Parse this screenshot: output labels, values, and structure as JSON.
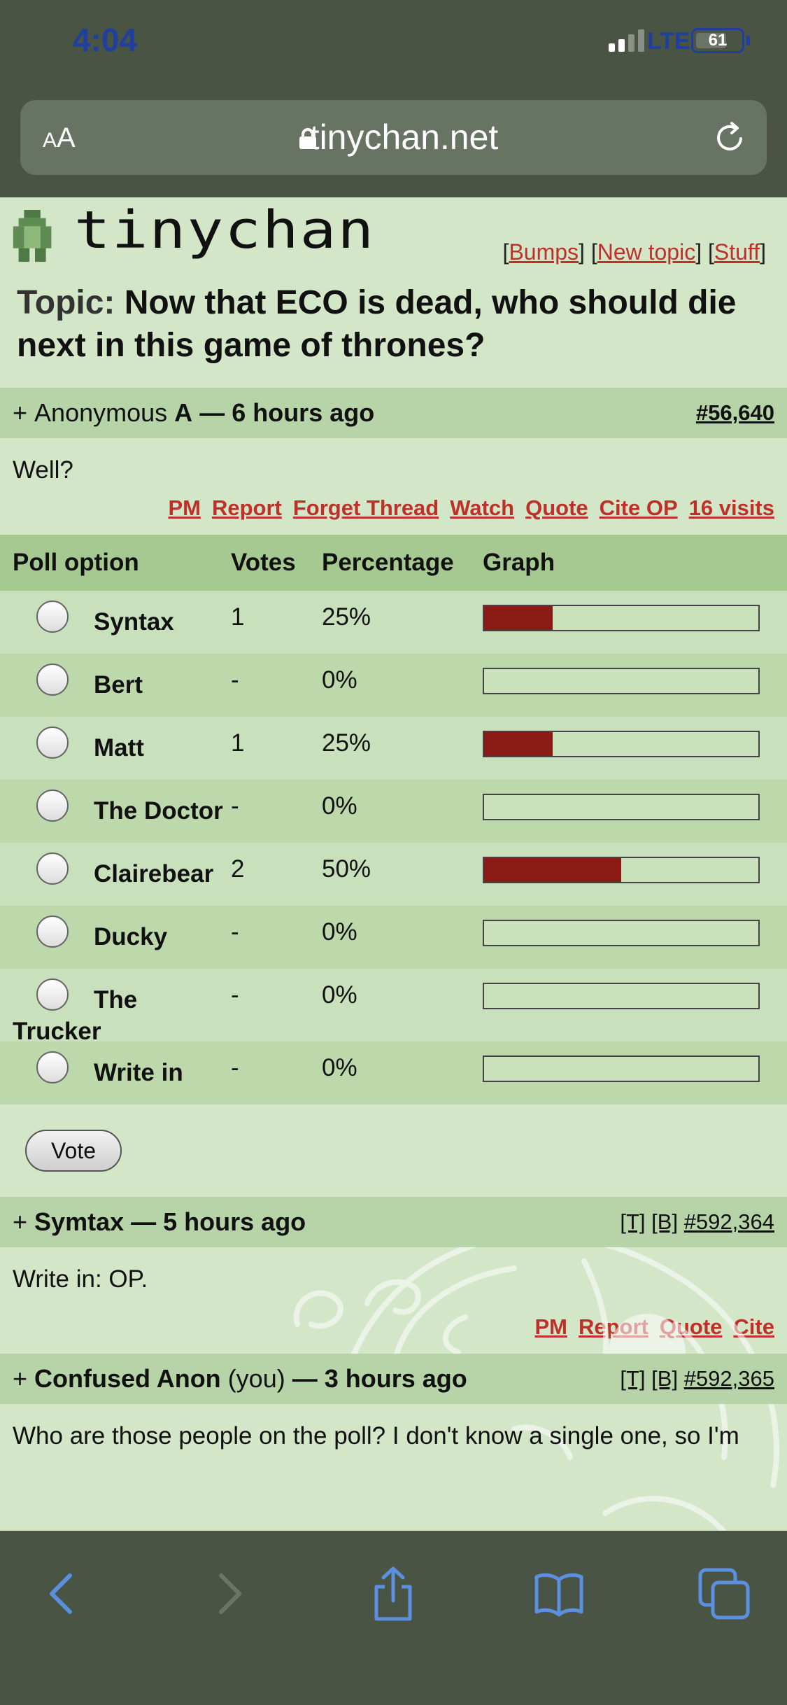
{
  "status": {
    "time": "4:04",
    "network": "LTE",
    "battery": "61"
  },
  "browser": {
    "text_size_label": "AA",
    "url": "tinychan.net"
  },
  "site": {
    "logo": "tinychan",
    "links": [
      "Bumps",
      "New topic",
      "Stuff"
    ]
  },
  "topic": {
    "label": "Topic:",
    "title": "Now that ECO is dead, who should die next in this game of thrones?"
  },
  "op": {
    "expand": "+",
    "author": "Anonymous",
    "author_tag": "A",
    "time": "— 6 hours ago",
    "id": "#56,640",
    "body": "Well?",
    "actions": [
      "PM",
      "Report",
      "Forget Thread",
      "Watch",
      "Quote",
      "Cite OP",
      "16 visits"
    ]
  },
  "poll": {
    "headers": {
      "option": "Poll option",
      "votes": "Votes",
      "percentage": "Percentage",
      "graph": "Graph"
    },
    "options": [
      {
        "name": "Syntax",
        "votes": "1",
        "percentage": "25%",
        "fraction": 0.25
      },
      {
        "name": "Bert",
        "votes": "-",
        "percentage": "0%",
        "fraction": 0
      },
      {
        "name": "Matt",
        "votes": "1",
        "percentage": "25%",
        "fraction": 0.25
      },
      {
        "name": "The Doctor",
        "votes": "-",
        "percentage": "0%",
        "fraction": 0
      },
      {
        "name": "Clairebear",
        "votes": "2",
        "percentage": "50%",
        "fraction": 0.5
      },
      {
        "name": "Ducky",
        "votes": "-",
        "percentage": "0%",
        "fraction": 0
      },
      {
        "name": "The Trucker",
        "votes": "-",
        "percentage": "0%",
        "fraction": 0
      },
      {
        "name": "Write in",
        "votes": "-",
        "percentage": "0%",
        "fraction": 0
      }
    ],
    "vote_button": "Vote",
    "bar_color": "#8a1a14"
  },
  "replies": [
    {
      "expand": "+",
      "author": "Symtax",
      "time": "— 5 hours ago",
      "t": "[T]",
      "b": "[B]",
      "id": "#592,364",
      "body": "Write in: OP.",
      "actions": [
        "PM",
        "Report",
        "Quote",
        "Cite"
      ]
    },
    {
      "expand": "+",
      "author": "Confused Anon",
      "you": "(you)",
      "time": "— 3 hours ago",
      "t": "[T]",
      "b": "[B]",
      "id": "#592,365",
      "body": "Who are those people on the poll? I don't know a single one, so I'm"
    }
  ],
  "toolbar": {
    "icons": [
      "back-icon",
      "forward-icon",
      "share-icon",
      "bookmarks-icon",
      "tabs-icon"
    ]
  }
}
